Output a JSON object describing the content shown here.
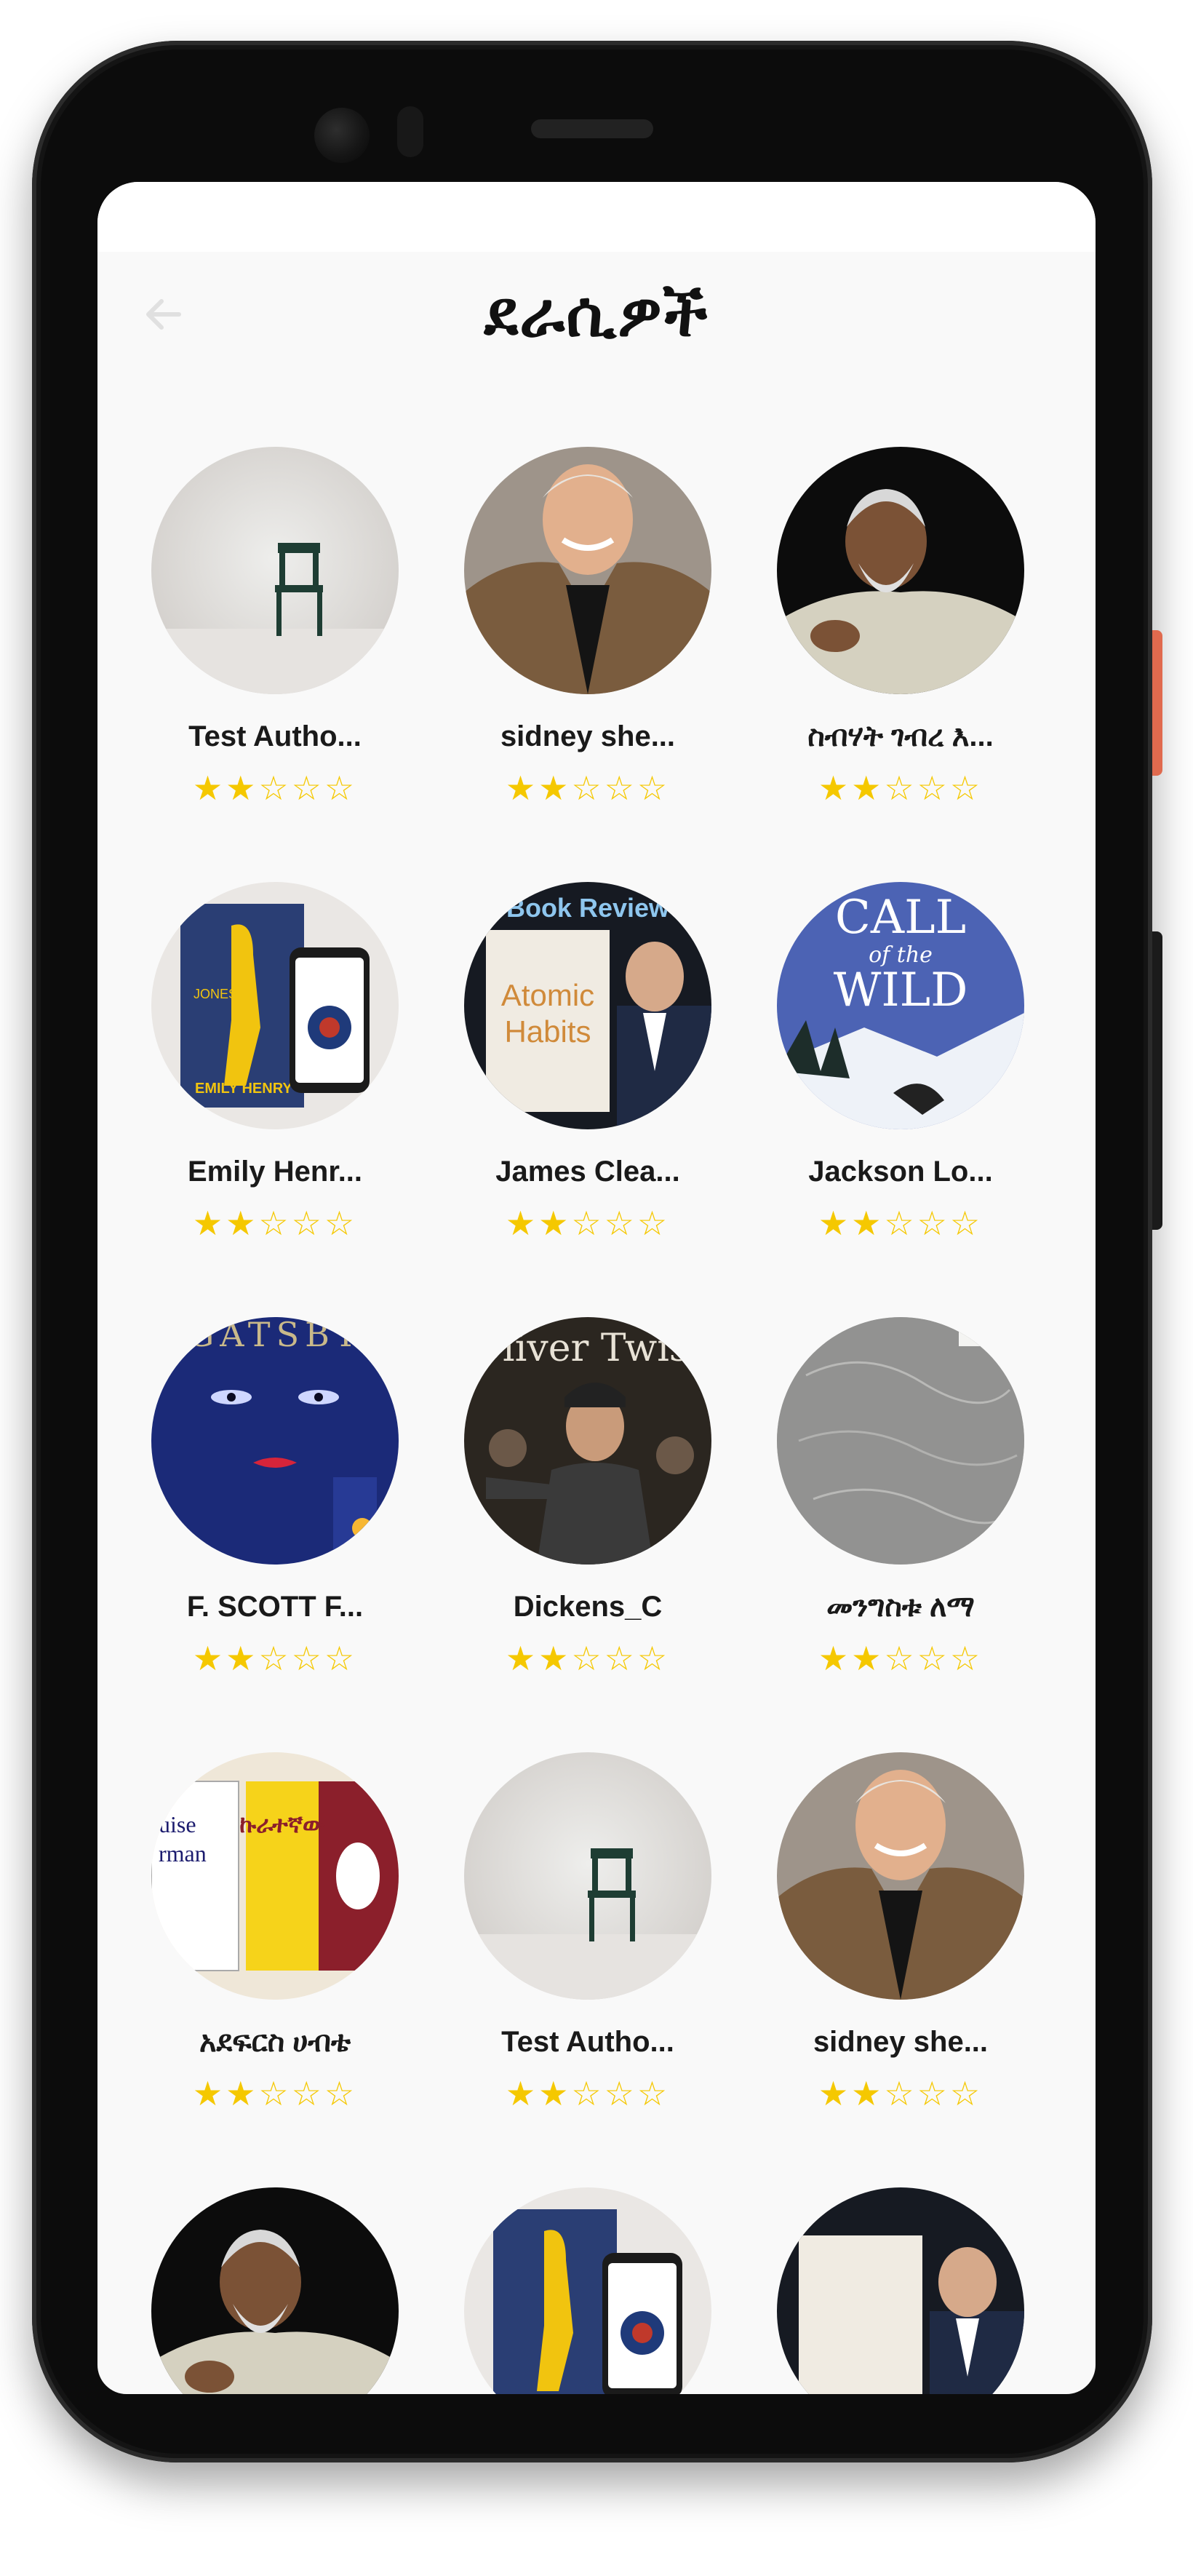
{
  "header": {
    "title": "ደራሲዎች",
    "back_icon": "arrow-left-icon"
  },
  "colors": {
    "star": "#f5c800",
    "background": "#f9f9f9",
    "side_button_accent": "#e06a4e"
  },
  "authors": [
    {
      "name": "Test Autho...",
      "rating": 2,
      "max_rating": 5
    },
    {
      "name": "sidney she...",
      "rating": 2,
      "max_rating": 5
    },
    {
      "name": "ስብሃት ገብረ እ...",
      "rating": 2,
      "max_rating": 5
    },
    {
      "name": "Emily Henr...",
      "rating": 2,
      "max_rating": 5
    },
    {
      "name": "James Clea...",
      "rating": 2,
      "max_rating": 5
    },
    {
      "name": "Jackson Lo...",
      "rating": 2,
      "max_rating": 5
    },
    {
      "name": "F. SCOTT F...",
      "rating": 2,
      "max_rating": 5
    },
    {
      "name": "Dickens_C",
      "rating": 2,
      "max_rating": 5
    },
    {
      "name": "መንግስቱ ለማ",
      "rating": 2,
      "max_rating": 5
    },
    {
      "name": "አደፍርስ ሀብቴ",
      "rating": 2,
      "max_rating": 5
    },
    {
      "name": "Test Autho...",
      "rating": 2,
      "max_rating": 5
    },
    {
      "name": "sidney she...",
      "rating": 2,
      "max_rating": 5
    },
    {
      "name": "",
      "rating": 0,
      "max_rating": 0
    },
    {
      "name": "",
      "rating": 0,
      "max_rating": 0
    },
    {
      "name": "",
      "rating": 0,
      "max_rating": 0
    }
  ],
  "images": {
    "chair": {
      "sign": "",
      "top": "",
      "sub": ""
    },
    "sidney": {
      "sign": "",
      "top": "",
      "sub": ""
    },
    "sebhat": {
      "sign": "",
      "top": "",
      "sub": ""
    },
    "emily": {
      "sign": "",
      "top": "JONES",
      "sub": "EMILY HENRY"
    },
    "atomic": {
      "sign": "Book Review",
      "top": "Atomic",
      "sub": "Habits"
    },
    "wild": {
      "sign": "CALL",
      "top": "of the",
      "sub": "WILD"
    },
    "gatsby": {
      "sign": "GATSBY",
      "top": "",
      "sub": ""
    },
    "oliver": {
      "sign": "Oliver Twist",
      "top": "",
      "sub": ""
    },
    "sketch": {
      "sign": "",
      "top": "",
      "sub": ""
    },
    "adefris": {
      "sign": "ኩራተኛው",
      "top": "uise",
      "sub": "rman"
    }
  }
}
